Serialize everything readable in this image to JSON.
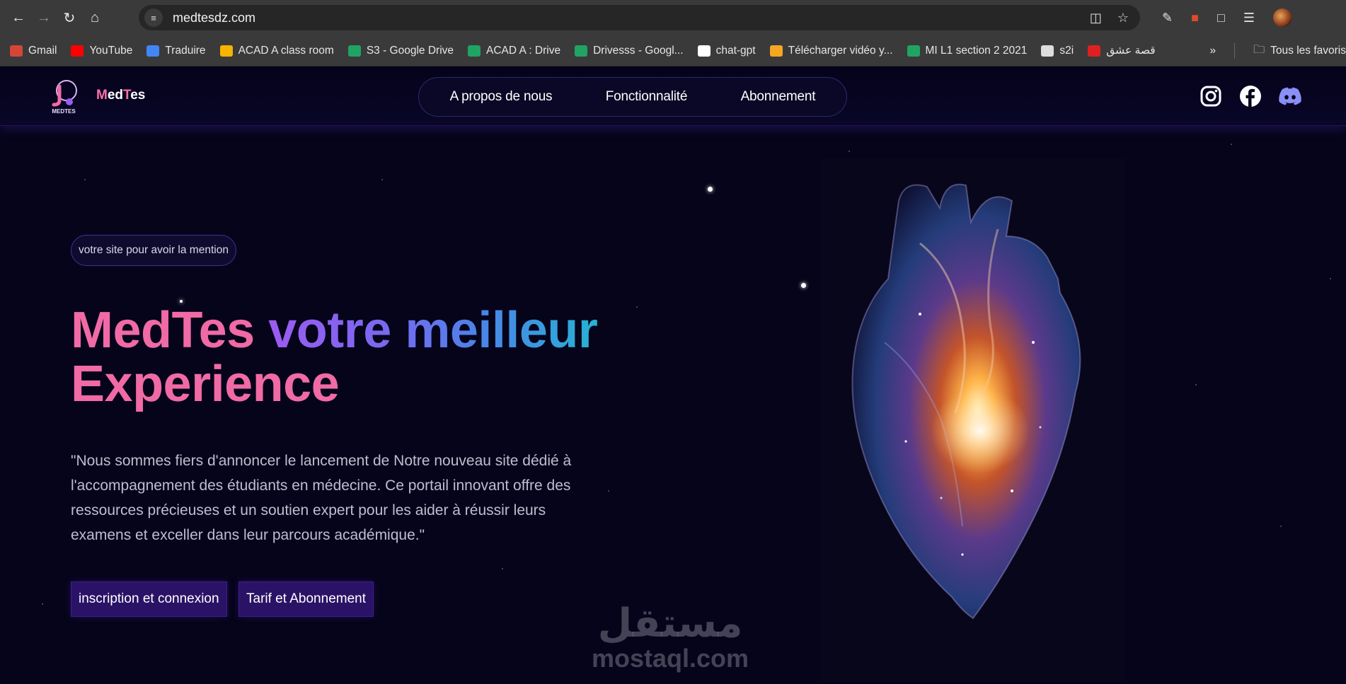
{
  "browser": {
    "url": "medtesdz.com",
    "bookmarks": [
      {
        "label": "Gmail",
        "color": "#d44638"
      },
      {
        "label": "YouTube",
        "color": "#ff0000"
      },
      {
        "label": "Traduire",
        "color": "#4285f4"
      },
      {
        "label": "ACAD A class room",
        "color": "#f5b400"
      },
      {
        "label": "S3 - Google Drive",
        "color": "#1fa463"
      },
      {
        "label": "ACAD A : Drive",
        "color": "#1fa463"
      },
      {
        "label": "Drivesss - Googl...",
        "color": "#1fa463"
      },
      {
        "label": "chat-gpt",
        "color": "#ffffff"
      },
      {
        "label": "Télécharger vidéo y...",
        "color": "#f5a623"
      },
      {
        "label": "MI L1 section 2 2021",
        "color": "#1fa463"
      },
      {
        "label": "s2i",
        "color": "#dddddd"
      },
      {
        "label": "قصة عشق",
        "color": "#e02020"
      }
    ],
    "more_label": "»",
    "all_bookmarks_label": "Tous les favoris"
  },
  "site": {
    "brand": "MedTes",
    "brand_first_letter": "M",
    "brand_rest_part1": "ed",
    "brand_t": "T",
    "brand_rest_part2": "es",
    "logo_caption": "MEDTES",
    "nav": [
      "A propos de nous",
      "Fonctionnalité",
      "Abonnement"
    ],
    "socials": [
      "instagram-icon",
      "facebook-icon",
      "discord-icon"
    ]
  },
  "hero": {
    "pill": "votre site pour avoir la mention",
    "title_part1": "MedTes",
    "title_part2": "votre meilleur",
    "title_part3": "Experience",
    "description": "\"Nous sommes fiers d'annoncer le lancement de Notre nouveau site dédié à l'accompagnement des étudiants en médecine. Ce portail innovant offre des ressources précieuses et un soutien expert pour les aider à réussir leurs examens et exceller dans leur parcours académique.\"",
    "buttons": [
      "inscription et connexion",
      "Tarif et Abonnement"
    ]
  },
  "watermark": {
    "arabic": "مستقل",
    "latin": "mostaql.com"
  },
  "colors": {
    "accent_pink": "#f06aa6",
    "accent_purple": "#9a5cf0",
    "accent_blue": "#27b2d4",
    "button_bg": "#2a1366",
    "page_bg": "#06041a"
  }
}
